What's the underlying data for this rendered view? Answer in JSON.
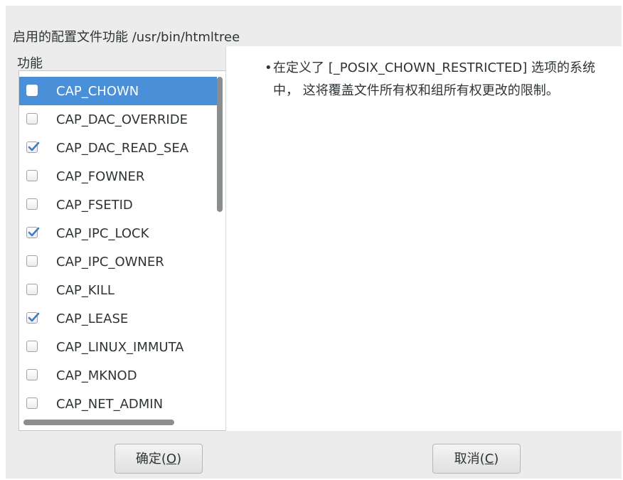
{
  "dialog": {
    "title": "启用的配置文件功能 /usr/bin/htmltree",
    "list_label": "功能",
    "capabilities": [
      {
        "name": "CAP_CHOWN",
        "checked": false,
        "selected": true
      },
      {
        "name": "CAP_DAC_OVERRIDE",
        "checked": false,
        "selected": false
      },
      {
        "name": "CAP_DAC_READ_SEA",
        "checked": true,
        "selected": false
      },
      {
        "name": "CAP_FOWNER",
        "checked": false,
        "selected": false
      },
      {
        "name": "CAP_FSETID",
        "checked": false,
        "selected": false
      },
      {
        "name": "CAP_IPC_LOCK",
        "checked": true,
        "selected": false
      },
      {
        "name": "CAP_IPC_OWNER",
        "checked": false,
        "selected": false
      },
      {
        "name": "CAP_KILL",
        "checked": false,
        "selected": false
      },
      {
        "name": "CAP_LEASE",
        "checked": true,
        "selected": false
      },
      {
        "name": "CAP_LINUX_IMMUTA",
        "checked": false,
        "selected": false
      },
      {
        "name": "CAP_MKNOD",
        "checked": false,
        "selected": false
      },
      {
        "name": "CAP_NET_ADMIN",
        "checked": false,
        "selected": false
      }
    ],
    "description_bullet": "•",
    "description": "在定义了 [_POSIX_CHOWN_RESTRICTED] 选项的系统中， 这将覆盖文件所有权和组所有权更改的限制。",
    "ok_button": {
      "label": "确定(",
      "mnemonic": "O",
      "suffix": ")"
    },
    "cancel_button": {
      "label": "取消(",
      "mnemonic": "C",
      "suffix": ")"
    },
    "colors": {
      "selection": "#4a90d9",
      "check": "#3f7fc6",
      "background": "#ececec"
    }
  }
}
